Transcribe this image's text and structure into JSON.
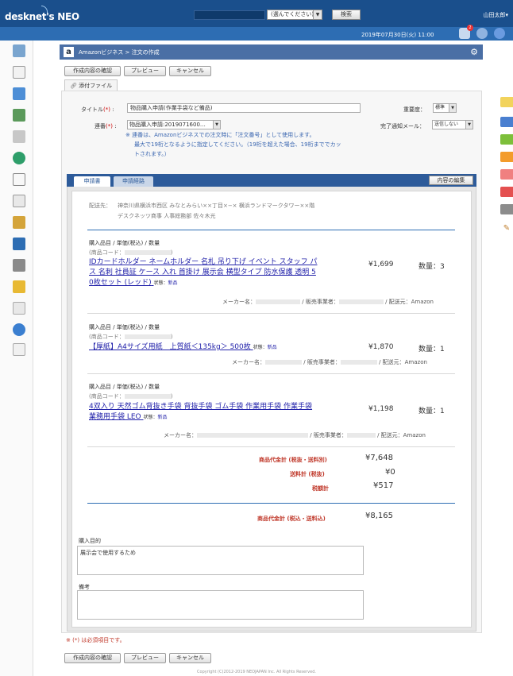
{
  "header": {
    "logo_text": "desknet's NEO",
    "select_label": "(選んでください)",
    "search_button": "検索",
    "user_name": "山田太郎▾",
    "datetime": "2019年07月30日(火) 11:00",
    "notification_count": "2"
  },
  "panel": {
    "logo_letter": "a",
    "title": "Amazonビジネス > 注文の作成",
    "buttons": {
      "confirm": "作成内容の確認",
      "preview": "プレビュー",
      "cancel": "キャンセル"
    },
    "attach_tab": "添付ファイル"
  },
  "form": {
    "title_label": "タイトル",
    "req_mark": "(*)",
    "colon": ":",
    "title_value": "物品購入申請(作業手袋など備品)",
    "importance_label": "重要度：",
    "importance_value": "標準",
    "route_label": "連番",
    "route_value": "物品購入申請:2019071600…",
    "notify_label": "完了通知メール：",
    "notify_value": "送信しない",
    "note_lines": [
      "※ 連番は、Amazonビジネスでの注文時に「注文番号」として使用します。",
      "最大で19桁となるように指定してください。（19桁を超えた場合、19桁まででカッ",
      "トされます。）"
    ]
  },
  "tabs": {
    "apply": "申請書",
    "route": "申請経路",
    "edit_button": "内容の編集"
  },
  "sheet": {
    "ship_label": "配送先：",
    "ship_line1": "神奈川県横浜市西区 みなとみらい××丁目×−× 横浜ランドマークタワー××階",
    "ship_line2": "デスクネッツ商事 人事総務部 佐々木光",
    "item_header": "購入品目 / 単価(税込) / 数量",
    "code_open": "(商品コード：",
    "code_close": ")",
    "state_label": "状態：",
    "maker_label": "メーカー名：",
    "seller_label": "/ 販売事業者：",
    "delivery_label": "/ 配送元：Amazon",
    "items": [
      {
        "name_lines": [
          "IDカードホルダー ネームホルダー 名札 吊り下げ イベント スタッフ パ",
          "ス 名刺 社員証 ケース 入れ 首掛け 展示会 横型タイプ 防水保護 透明 5",
          "0枚セット (レッド)"
        ],
        "state": "新品",
        "price": "¥1,699",
        "qty": "数量：3"
      },
      {
        "name_lines": [
          "【厚紙】A4サイズ用紙　上質紙＜135kg＞ 500枚"
        ],
        "state": "新品",
        "price": "¥1,870",
        "qty": "数量：1"
      },
      {
        "name_lines": [
          "4双入り 天然ゴム背抜き手袋 背抜手袋 ゴム手袋 作業用手袋 作業手袋",
          "業務用手袋 LEO"
        ],
        "state": "新品",
        "price": "¥1,198",
        "qty": "数量：1"
      }
    ],
    "summary": {
      "subtotal_label": "商品代金計 (税抜・送料別)",
      "subtotal": "¥7,648",
      "shipping_label": "送料計 (税抜)",
      "shipping": "¥0",
      "tax_label": "税額計",
      "tax": "¥517",
      "total_label": "商品代金計 (税込・送料込)",
      "total": "¥8,165"
    },
    "purpose_label": "購入目的",
    "purpose_value": "展示会で使用するため",
    "remarks_label": "備考",
    "remarks_value": ""
  },
  "required_note": "※ (*) は必須項目です。",
  "footer": "Copyright (C)2012-2019 NEOJAPAN Inc. All Rights Reserved.",
  "colors": {
    "header": "#1a4f8c",
    "subbar": "#2d6db3",
    "panel_title": "#4a6fa5",
    "link": "#2222aa",
    "sum_label": "#c0392b"
  }
}
